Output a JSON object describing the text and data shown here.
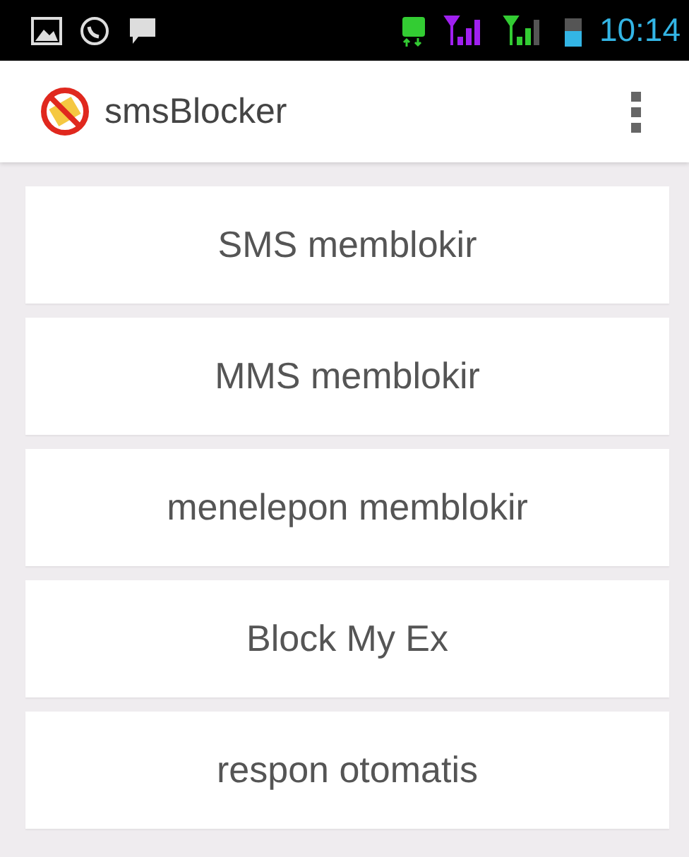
{
  "status_bar": {
    "time": "10:14"
  },
  "app_bar": {
    "title": "smsBlocker"
  },
  "menu_items": [
    {
      "label": "SMS memblokir"
    },
    {
      "label": "MMS memblokir"
    },
    {
      "label": "menelepon memblokir"
    },
    {
      "label": "Block My Ex"
    },
    {
      "label": "respon otomatis"
    }
  ]
}
